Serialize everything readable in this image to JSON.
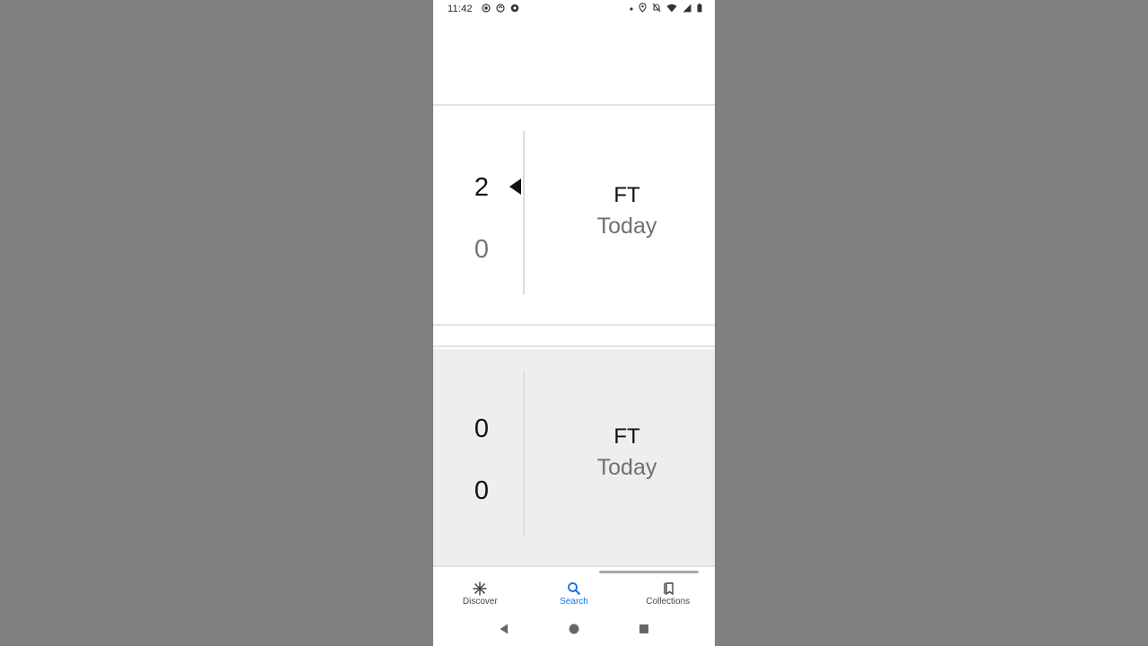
{
  "status_bar": {
    "time": "11:42",
    "left_icons": [
      "screen-record-icon",
      "sync-icon",
      "football-icon"
    ],
    "right_icons": [
      "dot-icon",
      "location-icon",
      "mute-icon",
      "wifi-icon",
      "signal-icon",
      "battery-icon"
    ]
  },
  "matches": [
    {
      "team1_score": "2",
      "team2_score": "0",
      "status": "FT",
      "date": "Today",
      "winner_indicator": "team1"
    },
    {
      "team1_score": "0",
      "team2_score": "0",
      "status": "FT",
      "date": "Today",
      "winner_indicator": "none"
    }
  ],
  "bottom_nav": {
    "items": [
      {
        "label": "Discover",
        "icon": "asterisk-icon",
        "active": false
      },
      {
        "label": "Search",
        "icon": "search-icon",
        "active": true
      },
      {
        "label": "Collections",
        "icon": "collections-icon",
        "active": false
      }
    ],
    "active_color": "#1a73e8"
  },
  "system_nav": [
    "back-icon",
    "home-icon",
    "recents-icon"
  ]
}
